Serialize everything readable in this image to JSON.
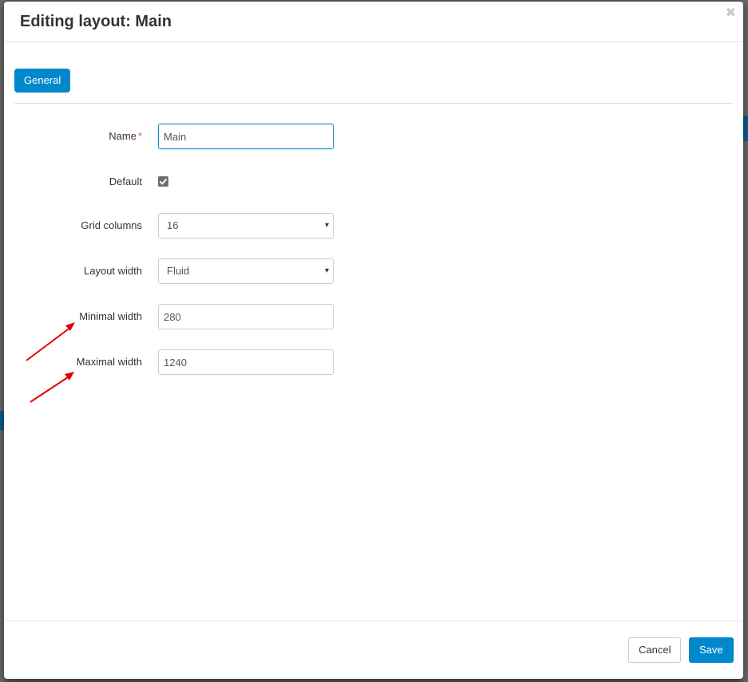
{
  "dialog": {
    "title": "Editing layout: Main",
    "close_icon": "close-icon"
  },
  "tabs": [
    {
      "label": "General",
      "active": true
    }
  ],
  "form": {
    "name": {
      "label": "Name",
      "required_marker": "*",
      "value": "Main"
    },
    "default": {
      "label": "Default",
      "checked": true
    },
    "grid_columns": {
      "label": "Grid columns",
      "value": "16"
    },
    "layout_width": {
      "label": "Layout width",
      "value": "Fluid"
    },
    "minimal_width": {
      "label": "Minimal width",
      "value": "280"
    },
    "maximal_width": {
      "label": "Maximal width",
      "value": "1240"
    }
  },
  "footer": {
    "cancel_label": "Cancel",
    "save_label": "Save"
  },
  "colors": {
    "accent": "#0088cc",
    "annotation_arrow": "#e00000",
    "required": "#d9534f"
  }
}
